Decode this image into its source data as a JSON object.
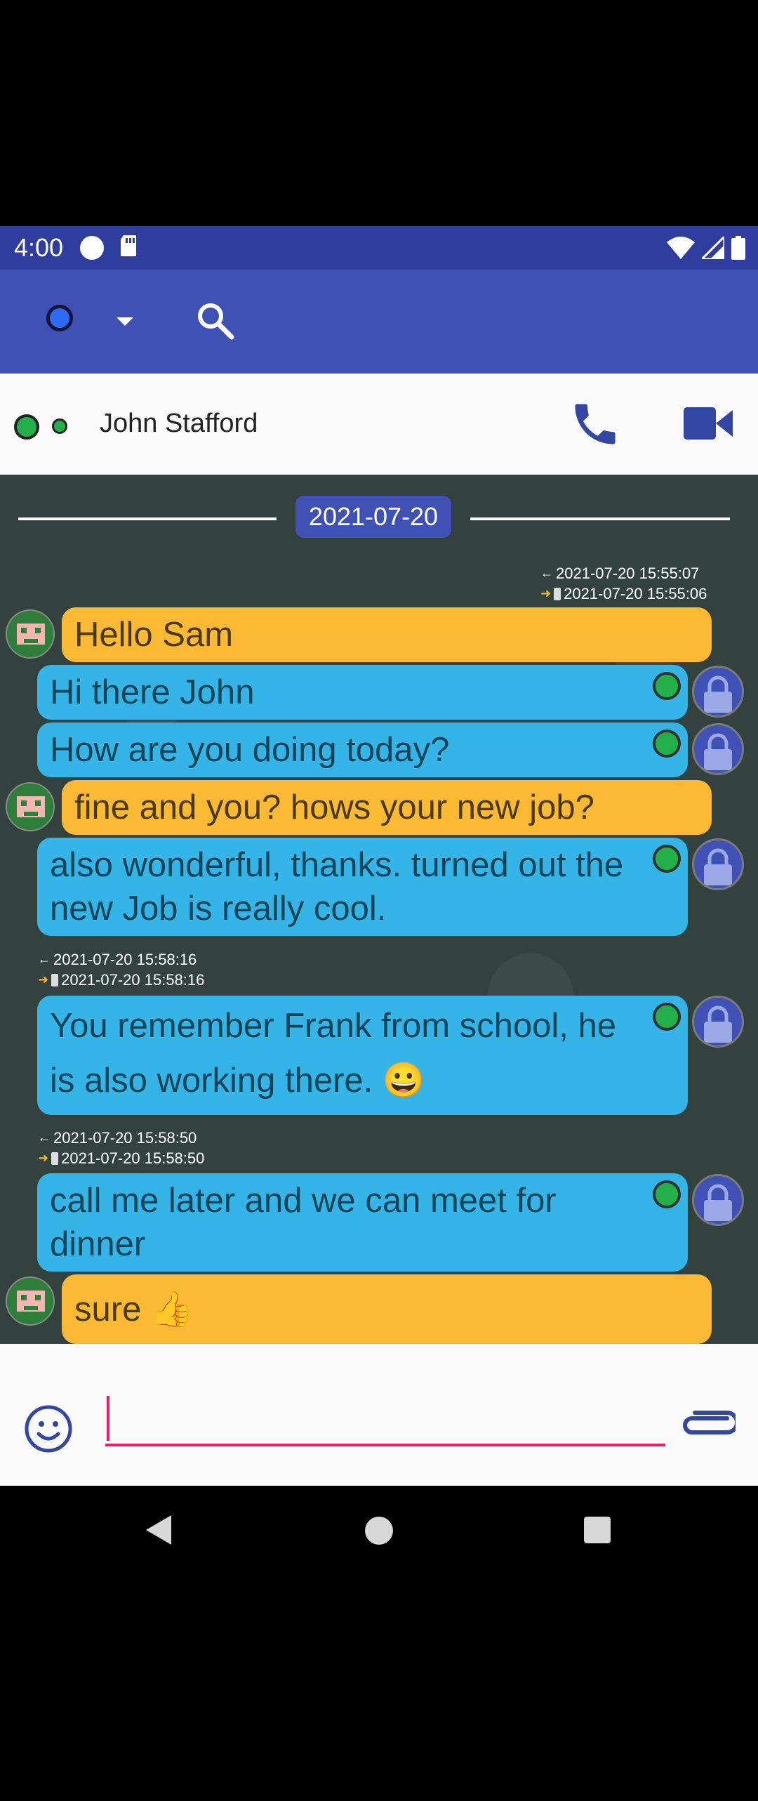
{
  "status_bar": {
    "time": "4:00"
  },
  "contact": {
    "name": "John Stafford"
  },
  "chat": {
    "date_separator": "2021-07-20",
    "timestamps": {
      "t1_received": "2021-07-20 15:55:07",
      "t1_sent": "2021-07-20 15:55:06",
      "t2_received": "2021-07-20 15:58:16",
      "t2_sent": "2021-07-20 15:58:16",
      "t3_received": "2021-07-20 15:58:50",
      "t3_sent": "2021-07-20 15:58:50"
    },
    "messages": [
      {
        "direction": "incoming",
        "text": "Hello Sam"
      },
      {
        "direction": "outgoing",
        "text": "Hi there John"
      },
      {
        "direction": "outgoing",
        "text": "How are you doing today?"
      },
      {
        "direction": "incoming",
        "text": "fine and you? hows your new job?"
      },
      {
        "direction": "outgoing",
        "text": "also wonderful, thanks. turned out the new Job is really cool."
      },
      {
        "direction": "outgoing",
        "text": "You remember Frank from school, he is also working there. 😀"
      },
      {
        "direction": "outgoing",
        "text": "call me later and we can meet for dinner"
      },
      {
        "direction": "incoming",
        "text": "sure 👍"
      }
    ]
  },
  "composer": {
    "placeholder": "",
    "value": ""
  },
  "icons": {
    "status_bar": [
      "circle-icon",
      "sd-card-icon",
      "wifi-icon",
      "signal-icon",
      "battery-icon"
    ],
    "app_bar": [
      "presence-status-icon",
      "dropdown-arrow-icon",
      "search-icon"
    ],
    "contact_bar": [
      "online-indicator-icon",
      "phone-icon",
      "video-camera-icon"
    ],
    "composer": [
      "smiley-icon",
      "paperclip-icon"
    ],
    "nav": [
      "back-icon",
      "home-icon",
      "recents-icon"
    ]
  },
  "colors": {
    "status_bar": "#2f3e9e",
    "app_bar": "#3f51b5",
    "incoming_bubble": "#fbb934",
    "outgoing_bubble": "#35b4e7",
    "online": "#23b04a",
    "input_underline": "#e91e63"
  }
}
